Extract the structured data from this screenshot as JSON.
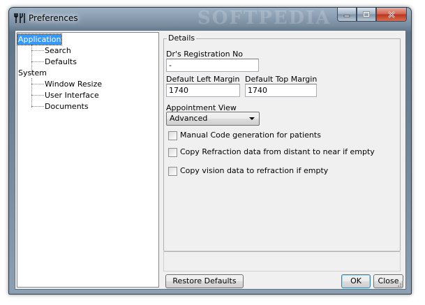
{
  "window": {
    "title": "Preferences",
    "watermark": "SOFTPEDIA",
    "controls": {
      "minimize": "minimize",
      "maximize": "maximize",
      "close": "close"
    }
  },
  "tree": {
    "items": [
      {
        "label": "Application",
        "level": 0,
        "selected": true
      },
      {
        "label": "Search",
        "level": 1
      },
      {
        "label": "Defaults",
        "level": 1
      },
      {
        "label": "System",
        "level": 0
      },
      {
        "label": "Window Resize",
        "level": 1
      },
      {
        "label": "User Interface",
        "level": 1
      },
      {
        "label": "Documents",
        "level": 1
      }
    ]
  },
  "details": {
    "legend": "Details",
    "dr_reg_label": "Dr's Registration No",
    "dr_reg_value": "-",
    "left_margin_label": "Default Left Margin",
    "left_margin_value": "1740",
    "top_margin_label": "Default Top Margin",
    "top_margin_value": "1740",
    "appointment_label": "Appointment View",
    "appointment_value": "Advanced",
    "checkboxes": [
      {
        "label": "Manual Code generation for patients",
        "checked": false
      },
      {
        "label": "Copy Refraction data from distant to near if empty",
        "checked": false
      },
      {
        "label": "Copy vision data to refraction if empty",
        "checked": false
      }
    ]
  },
  "buttons": {
    "restore": "Restore Defaults",
    "ok": "OK",
    "close": "Close"
  },
  "colors": {
    "selection": "#3399ff",
    "face": "#f0f0f0",
    "close_button": "#c8432a"
  }
}
